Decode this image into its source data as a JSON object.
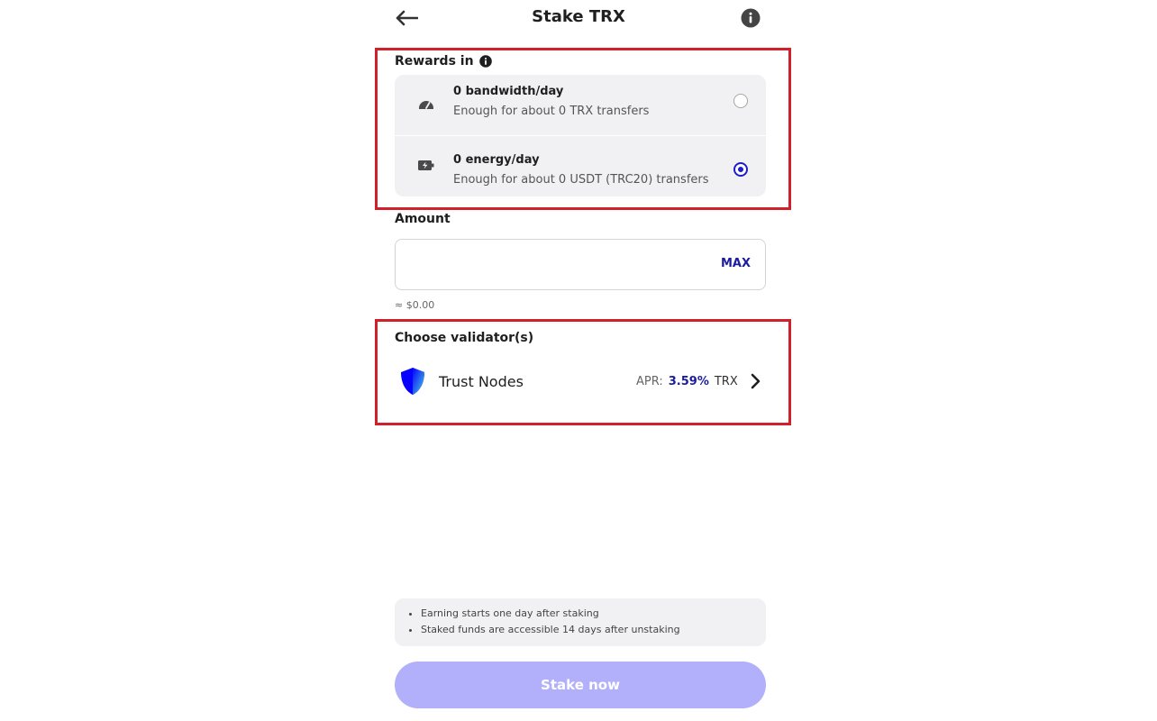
{
  "header": {
    "title": "Stake TRX",
    "back_icon": "arrow-left-icon",
    "info_icon": "info-icon"
  },
  "rewards": {
    "label": "Rewards in",
    "options": [
      {
        "title": "0 bandwidth/day",
        "subtitle": "Enough for about 0 TRX transfers",
        "icon": "speedometer-icon",
        "selected": false
      },
      {
        "title": "0 energy/day",
        "subtitle": "Enough for about 0 USDT (TRC20) transfers",
        "icon": "battery-charging-icon",
        "selected": true
      }
    ]
  },
  "amount": {
    "label": "Amount",
    "value": "",
    "placeholder": "",
    "max_label": "MAX",
    "fiat": "≈ $0.00"
  },
  "validator": {
    "label": "Choose validator(s)",
    "name": "Trust Nodes",
    "apr_label": "APR:",
    "apr_value": "3.59%",
    "apr_unit": "TRX"
  },
  "notes": [
    "Earning starts one day after staking",
    "Staked funds are accessible 14 days after unstaking"
  ],
  "stake_button": {
    "label": "Stake now"
  },
  "colors": {
    "accent": "#1c1cd3",
    "highlight": "#d0202a",
    "button_disabled": "#b3b0fb",
    "card_bg": "#f1f1f3"
  }
}
